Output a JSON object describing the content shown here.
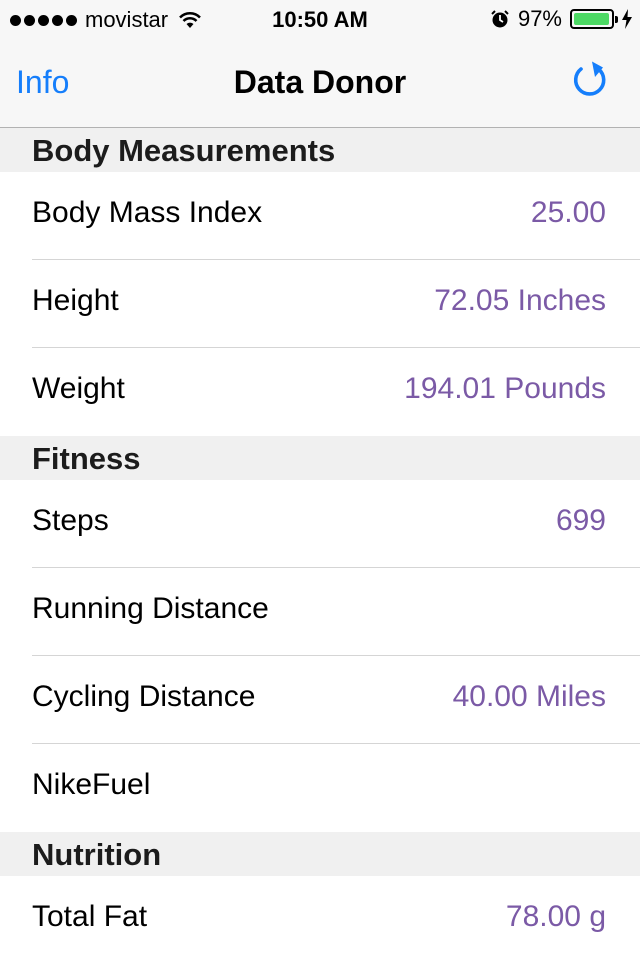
{
  "status_bar": {
    "carrier": "movistar",
    "time": "10:50 AM",
    "battery": "97%",
    "battery_level": 0.97,
    "signal_bars": 5
  },
  "nav": {
    "left_label": "Info",
    "title": "Data Donor",
    "refresh_icon": "refresh-icon",
    "accent_color": "#157efb"
  },
  "sections": [
    {
      "title": "Body Measurements",
      "rows": [
        {
          "label": "Body Mass Index",
          "value": "25.00"
        },
        {
          "label": "Height",
          "value": "72.05 Inches"
        },
        {
          "label": "Weight",
          "value": "194.01 Pounds"
        }
      ]
    },
    {
      "title": "Fitness",
      "rows": [
        {
          "label": "Steps",
          "value": "699"
        },
        {
          "label": "Running Distance",
          "value": ""
        },
        {
          "label": "Cycling Distance",
          "value": "40.00 Miles"
        },
        {
          "label": "NikeFuel",
          "value": ""
        }
      ]
    },
    {
      "title": "Nutrition",
      "rows": [
        {
          "label": "Total Fat",
          "value": "78.00 g"
        }
      ]
    }
  ],
  "value_color": "#7b5aa6"
}
